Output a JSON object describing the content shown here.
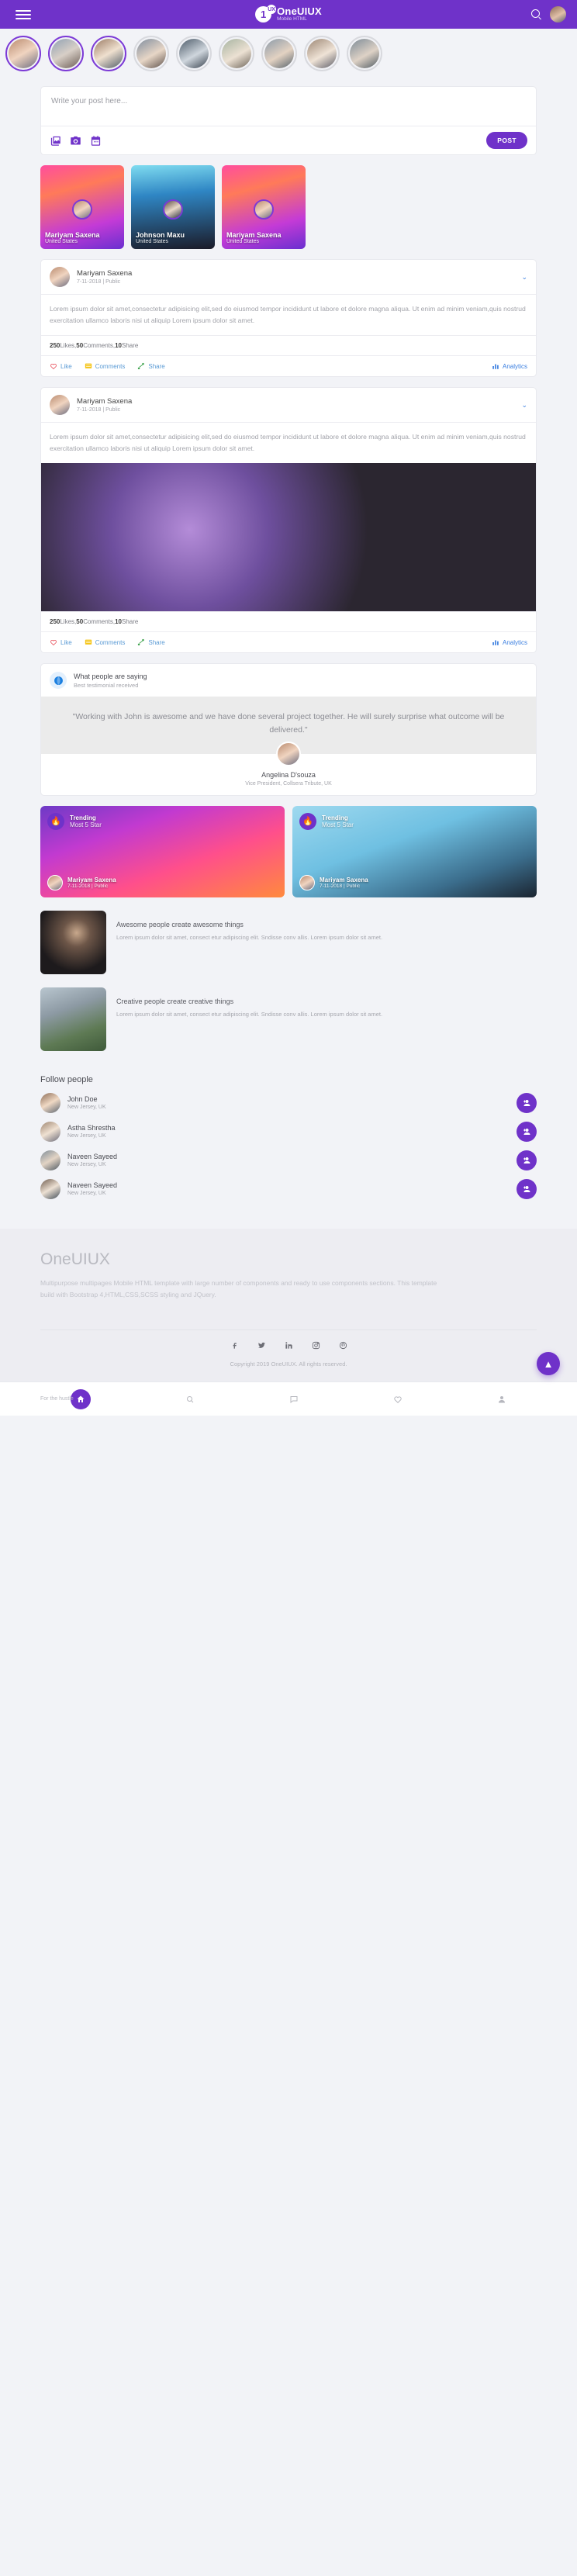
{
  "header": {
    "logo_number": "1",
    "logo_badge": "UX",
    "title": "OneUIUX",
    "subtitle": "Mobile HTML",
    "menu_icon": "hamburger-icon",
    "search_icon": "search-icon"
  },
  "composer": {
    "placeholder": "Write your post here...",
    "value": "",
    "icons": [
      "image-icon",
      "camera-icon",
      "calendar-icon"
    ],
    "post_label": "POST"
  },
  "story_cards": [
    {
      "name": "Mariyam Saxena",
      "location": "United States"
    },
    {
      "name": "Johnson Maxu",
      "location": "United States"
    },
    {
      "name": "Mariyam Saxena",
      "location": "United States"
    }
  ],
  "posts": [
    {
      "author": "Mariyam Saxena",
      "meta": "7-11-2018 | Public",
      "text": "Lorem ipsum dolor sit amet,consectetur adipisicing elit,sed do eiusmod tempor incididunt ut labore et dolore magna aliqua. Ut enim ad minim veniam,quis nostrud exercitation ullamco laboris nisi ut aliquip Lorem ipsum dolor sit amet.",
      "has_image": false,
      "likes": "250",
      "likes_label": "Likes",
      "comments": "50",
      "comments_label": "Comments",
      "shares": "10",
      "shares_label": "Share",
      "actions": {
        "like": "Like",
        "comments": "Comments",
        "share": "Share",
        "analytics": "Analytics"
      }
    },
    {
      "author": "Mariyam Saxena",
      "meta": "7-11-2018 | Public",
      "text": "Lorem ipsum dolor sit amet,consectetur adipisicing elit,sed do eiusmod tempor incididunt ut labore et dolore magna aliqua. Ut enim ad minim veniam,quis nostrud exercitation ullamco laboris nisi ut aliquip Lorem ipsum dolor sit amet.",
      "has_image": true,
      "likes": "250",
      "likes_label": "Likes",
      "comments": "50",
      "comments_label": "Comments",
      "shares": "10",
      "shares_label": "Share",
      "actions": {
        "like": "Like",
        "comments": "Comments",
        "share": "Share",
        "analytics": "Analytics"
      }
    }
  ],
  "testimonial": {
    "header_title": "What people are saying",
    "header_sub": "Best testimonial received",
    "quote": "\"Working with John is awesome and we have done several project together. He will surely surprise what outcome will be delivered.\"",
    "author": "Angelina D'souza",
    "role": "Vice President, Collsera Tribute, UK",
    "icon": "globe-icon"
  },
  "trending": [
    {
      "label": "Trending",
      "sub": "Most 5 Star",
      "name": "Mariyam Saxena",
      "meta": "7-11-2018 | Public",
      "icon": "fire-icon"
    },
    {
      "label": "Trending",
      "sub": "Most 5 Star",
      "name": "Mariyam Saxena",
      "meta": "7-11-2018 | Public",
      "icon": "fire-icon"
    }
  ],
  "articles": [
    {
      "title": "Awesome people create awesome things",
      "desc": "Lorem ipsum dolor sit amet, consect etur adipiscing elit. Sndisse conv allis. Lorem ipsum dolor sit amet."
    },
    {
      "title": "Creative people create creative things",
      "desc": "Lorem ipsum dolor sit amet, consect etur adipiscing elit. Sndisse conv allis. Lorem ipsum dolor sit amet."
    }
  ],
  "follow": {
    "title": "Follow people",
    "people": [
      {
        "name": "John Doe",
        "location": "New Jersey, UK"
      },
      {
        "name": "Astha Shrestha",
        "location": "New Jersey, UK"
      },
      {
        "name": "Naveen Sayeed",
        "location": "New Jersey, UK"
      },
      {
        "name": "Naveen Sayeed",
        "location": "New Jersey, UK"
      }
    ],
    "button_icon": "add-person-icon"
  },
  "footer": {
    "brand": "OneUIUX",
    "text": "Multipurpose multipages Mobile HTML template with large number of components and ready to use components sections. This template build with Bootstrap 4,HTML,CSS,SCSS styling and JQuery.",
    "social": [
      "facebook-icon",
      "twitter-icon",
      "linkedin-icon",
      "instagram-icon",
      "pinterest-icon"
    ],
    "copyright": "Copyright 2019 OneUIUX. All rights reserved."
  },
  "bottomnav": {
    "left_label": "For the hustle",
    "items": [
      "home-icon",
      "search-icon",
      "chat-icon",
      "heart-icon",
      "person-icon"
    ],
    "fab_icon": "arrow-up-icon"
  },
  "colors": {
    "brand": "#6f32c9",
    "bg": "#f2f3f7",
    "like": "#e8505b",
    "comment": "#f5c518",
    "share": "#3fa34d",
    "analytics": "#3b7fe0"
  }
}
